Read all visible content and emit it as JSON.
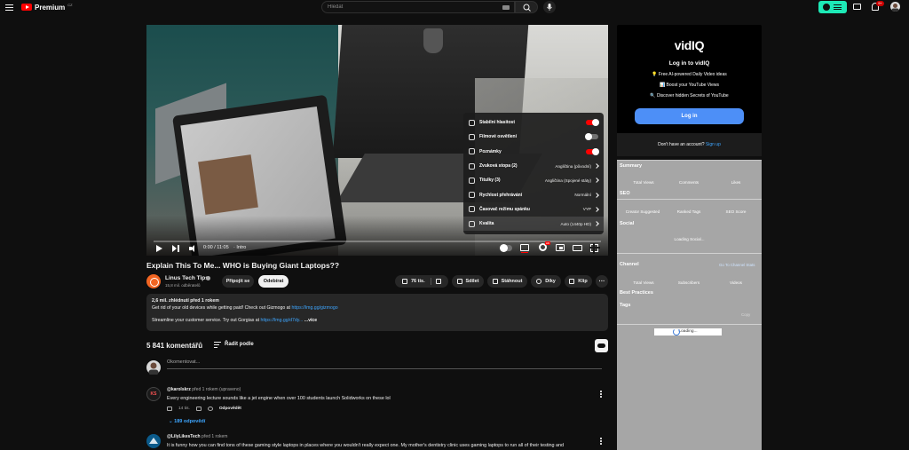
{
  "header": {
    "logo_text": "Premium",
    "logo_country": "CZ",
    "search_placeholder": "Hledat",
    "notifications_badge": "9+"
  },
  "player": {
    "time": "0:00 / 11:05",
    "chapter": "· Intro",
    "progress": 0.0,
    "settings": [
      {
        "label": "Stabilní hlasitost",
        "toggle": "on"
      },
      {
        "label": "Filmové osvětlení",
        "toggle": "off"
      },
      {
        "label": "Poznámky",
        "toggle": "on"
      },
      {
        "label": "Zvuková stopa (2)",
        "value": "Angličtina (původní)"
      },
      {
        "label": "Titulky (3)",
        "value": "Angličtina (Spojené státy)"
      },
      {
        "label": "Rychlost přehrávání",
        "value": "Normální"
      },
      {
        "label": "Časovač režimu spánku",
        "value": "VYP"
      },
      {
        "label": "Kvalita",
        "value": "Auto (1440p HD)"
      }
    ]
  },
  "video": {
    "title": "Explain This To Me... WHO is Buying Giant Laptops??",
    "channel_name": "Linus Tech Tips",
    "channel_subs": "15,8 mil. odběratelů",
    "join_label": "Připojit se",
    "subscribe_label": "Odebírat",
    "like_count": "76 tis.",
    "share_label": "Sdílet",
    "download_label": "Stáhnout",
    "thanks_label": "Díky",
    "clip_label": "Klip"
  },
  "description": {
    "stats": "2,6 mil. zhlédnutí  před 1 rokem",
    "line1": "Get rid of your old devices while getting paid! Check out Gizmogo at ",
    "link1": "https://lmg.gg/gizmogo",
    "line2": "Streamline your customer service. Try out Gorgias at ",
    "link2": "https://lmg.gg/d7dy...",
    "more": "...více"
  },
  "comments": {
    "count": "5 841 komentářů",
    "sort_label": "Řadit podle",
    "input_placeholder": "Okomentovat...",
    "items": [
      {
        "avatar_text": "KS",
        "author": "@karolskrz",
        "meta": "před 1 rokem (upraveno)",
        "text": "Every engineering lecture sounds like a jet engine when over 100 students launch Solidworks on these lol",
        "likes": "14 tis.",
        "reply_label": "Odpovědět",
        "replies": "189 odpovědí"
      },
      {
        "author": "@LilyLikesTech",
        "meta": "před 1 rokem",
        "text": "It is funny how you can find tons of these gaming style laptops in places where you wouldn't really expect one. My mother's dentistry clinic uses gaming laptops to run all of their testing and"
      }
    ]
  },
  "vidiq": {
    "logo": "vidIQ",
    "heading": "Log in to vidIQ",
    "features": [
      "💡 Free AI-powered Daily Video ideas",
      "📊 Boost your YouTube Views",
      "🔍 Discover hidden Secrets of YouTube"
    ],
    "login_label": "Log in",
    "no_account": "Don't have an account?",
    "signup": "Sign up"
  },
  "panel": {
    "summary": "Summary",
    "summary_cols": [
      "Total Views",
      "Comments",
      "Likes"
    ],
    "seo": "SEO",
    "seo_cols": [
      "Creator Suggested",
      "Ranked Tags",
      "SEO Score"
    ],
    "social": "Social",
    "loading_social": "Loading Social...",
    "channel": "Channel",
    "channel_link": "Go To Channel Stats",
    "channel_cols": [
      "Total Views",
      "Subscribers",
      "Videos"
    ],
    "best_practices": "Best Practices",
    "tags": "Tags",
    "copy": "Copy",
    "loading": "Loading..."
  },
  "colors": {
    "accent_red": "#ff0000",
    "vidiq_teal": "#1de9b6",
    "vidiq_blue": "#4d8ff7",
    "link_blue": "#3ea6ff"
  }
}
